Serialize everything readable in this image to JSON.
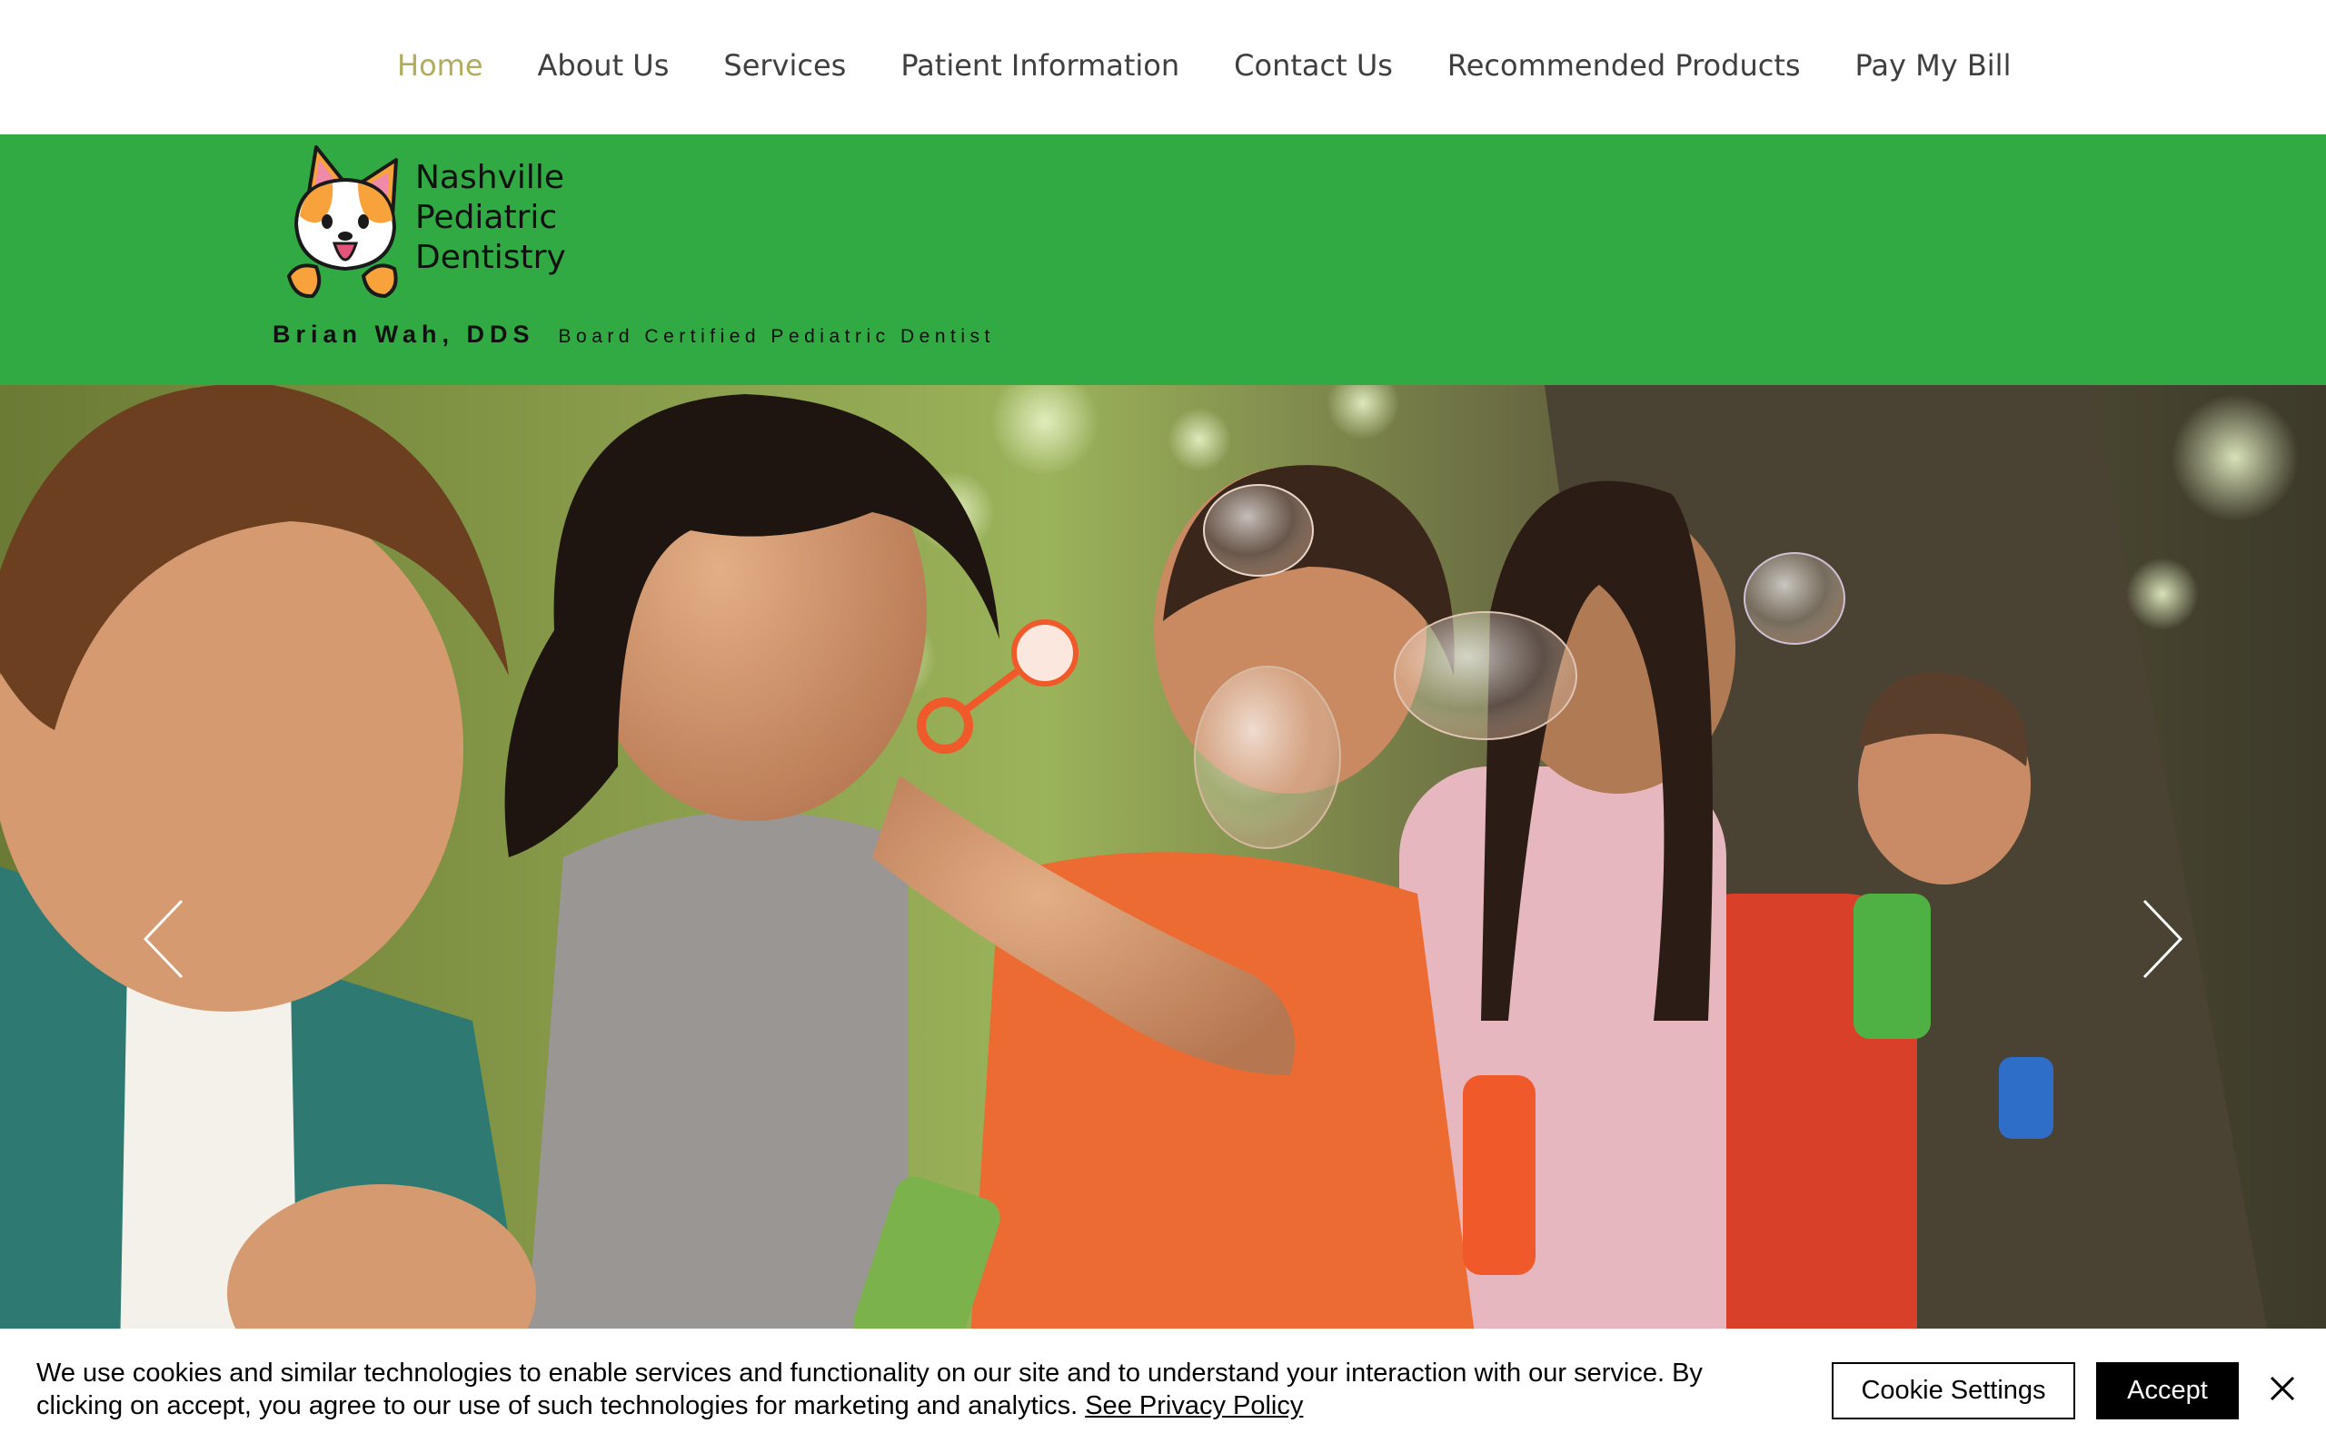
{
  "nav": {
    "items": [
      {
        "label": "Home",
        "active": true
      },
      {
        "label": "About Us",
        "active": false
      },
      {
        "label": "Services",
        "active": false
      },
      {
        "label": "Patient Information",
        "active": false
      },
      {
        "label": "Contact Us",
        "active": false
      },
      {
        "label": "Recommended Products",
        "active": false
      },
      {
        "label": "Pay My Bill",
        "active": false
      }
    ]
  },
  "header": {
    "background_color": "#32aa44",
    "logo": {
      "icon": "corgi-logo-icon",
      "lines": [
        "Nashville",
        "Pediatric",
        "Dentistry"
      ]
    },
    "doctor_name": "Brian Wah, DDS",
    "doctor_title": "Board Certified Pediatric Dentist"
  },
  "hero": {
    "slideshow": {
      "prev_icon": "chevron-left-icon",
      "next_icon": "chevron-right-icon"
    }
  },
  "cookie_banner": {
    "text": "We use cookies and similar technologies to enable services and functionality on our site and to understand your interaction with our service. By clicking on accept, you agree to our use of such technologies for marketing and analytics.",
    "link_label": "See Privacy Policy",
    "settings_label": "Cookie Settings",
    "accept_label": "Accept",
    "close_icon": "close-icon"
  },
  "colors": {
    "nav_active": "#b3ab5f",
    "nav_text": "#3f3f3f",
    "header_green": "#32aa44",
    "accept_bg": "#000000"
  }
}
